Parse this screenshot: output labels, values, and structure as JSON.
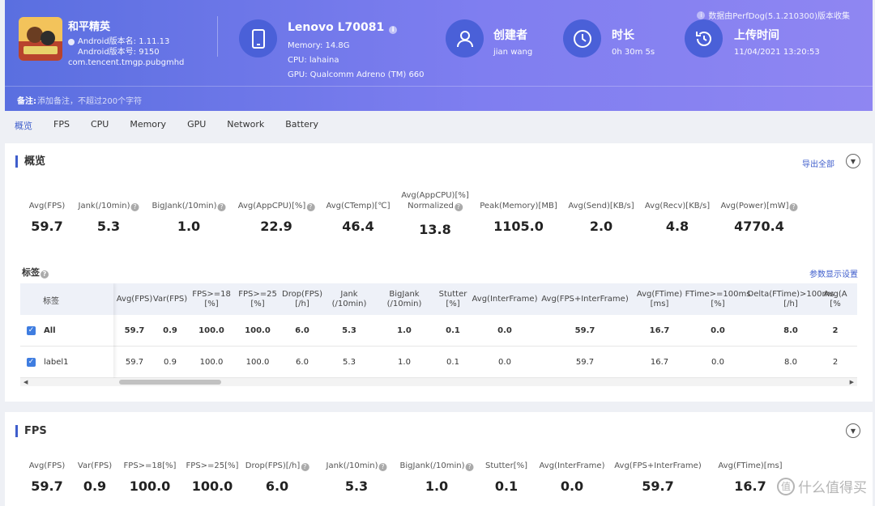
{
  "header": {
    "app_name": "和平精英",
    "android_version": "Android版本名: 1.11.13",
    "android_code": "Android版本号: 9150",
    "package": "com.tencent.tmgp.pubgmhd",
    "device_name": "Lenovo L70081",
    "memory": "Memory: 14.8G",
    "cpu": "CPU: lahaina",
    "gpu": "GPU: Qualcomm Adreno (TM) 660",
    "creator_label": "创建者",
    "creator_value": "jian wang",
    "duration_label": "时长",
    "duration_value": "0h 30m 5s",
    "upload_label": "上传时间",
    "upload_value": "11/04/2021 13:20:53",
    "source_note": "数据由PerfDog(5.1.210300)版本收集",
    "note_label": "备注:",
    "note_placeholder": "添加备注，不超过200个字符"
  },
  "tabs": [
    "概览",
    "FPS",
    "CPU",
    "Memory",
    "GPU",
    "Network",
    "Battery"
  ],
  "overview": {
    "title": "概览",
    "export": "导出全部",
    "metrics": [
      {
        "label": "Avg(FPS)",
        "value": "59.7",
        "help": false
      },
      {
        "label": "Jank(/10min)",
        "value": "5.3",
        "help": true
      },
      {
        "label": "BigJank(/10min)",
        "value": "1.0",
        "help": true
      },
      {
        "label": "Avg(AppCPU)[%]",
        "value": "22.9",
        "help": true
      },
      {
        "label": "Avg(CTemp)[℃]",
        "value": "46.4",
        "help": false
      },
      {
        "label": "Avg(AppCPU)[%] Normalized",
        "value": "13.8",
        "help": true
      },
      {
        "label": "Peak(Memory)[MB]",
        "value": "1105.0",
        "help": false
      },
      {
        "label": "Avg(Send)[KB/s]",
        "value": "2.0",
        "help": false
      },
      {
        "label": "Avg(Recv)[KB/s]",
        "value": "4.8",
        "help": false
      },
      {
        "label": "Avg(Power)[mW]",
        "value": "4770.4",
        "help": true
      }
    ],
    "tag_title": "标签",
    "param_settings": "参数显示设置",
    "table_label_header": "标签",
    "columns": [
      "Avg(FPS)",
      "Var(FPS)",
      "FPS>=18 [%]",
      "FPS>=25 [%]",
      "Drop(FPS) [/h]",
      "Jank (/10min)",
      "BigJank (/10min)",
      "Stutter [%]",
      "Avg(InterFrame)",
      "Avg(FPS+InterFrame)",
      "Avg(FTime) [ms]",
      "FTime>=100ms [%]",
      "Delta(FTime)>100ms [/h]",
      "Avg(A [%"
    ],
    "rows": [
      {
        "label": "All",
        "cells": [
          "59.7",
          "0.9",
          "100.0",
          "100.0",
          "6.0",
          "5.3",
          "1.0",
          "0.1",
          "0.0",
          "59.7",
          "16.7",
          "0.0",
          "8.0",
          "2"
        ]
      },
      {
        "label": "label1",
        "cells": [
          "59.7",
          "0.9",
          "100.0",
          "100.0",
          "6.0",
          "5.3",
          "1.0",
          "0.1",
          "0.0",
          "59.7",
          "16.7",
          "0.0",
          "8.0",
          "2"
        ]
      }
    ]
  },
  "fps": {
    "title": "FPS",
    "metrics": [
      {
        "label": "Avg(FPS)",
        "value": "59.7",
        "help": false
      },
      {
        "label": "Var(FPS)",
        "value": "0.9",
        "help": false
      },
      {
        "label": "FPS>=18[%]",
        "value": "100.0",
        "help": false
      },
      {
        "label": "FPS>=25[%]",
        "value": "100.0",
        "help": false
      },
      {
        "label": "Drop(FPS)[/h]",
        "value": "6.0",
        "help": true
      },
      {
        "label": "Jank(/10min)",
        "value": "5.3",
        "help": true
      },
      {
        "label": "BigJank(/10min)",
        "value": "1.0",
        "help": true
      },
      {
        "label": "Stutter[%]",
        "value": "0.1",
        "help": false
      },
      {
        "label": "Avg(InterFrame)",
        "value": "0.0",
        "help": false
      },
      {
        "label": "Avg(FPS+InterFrame)",
        "value": "59.7",
        "help": false
      },
      {
        "label": "Avg(FTime)[ms]",
        "value": "16.7",
        "help": false
      }
    ]
  },
  "watermark": "什么值得买",
  "colors": {
    "accent": "#3f5ecc",
    "header_start": "#5a6fe0",
    "header_end": "#8f86f2"
  }
}
